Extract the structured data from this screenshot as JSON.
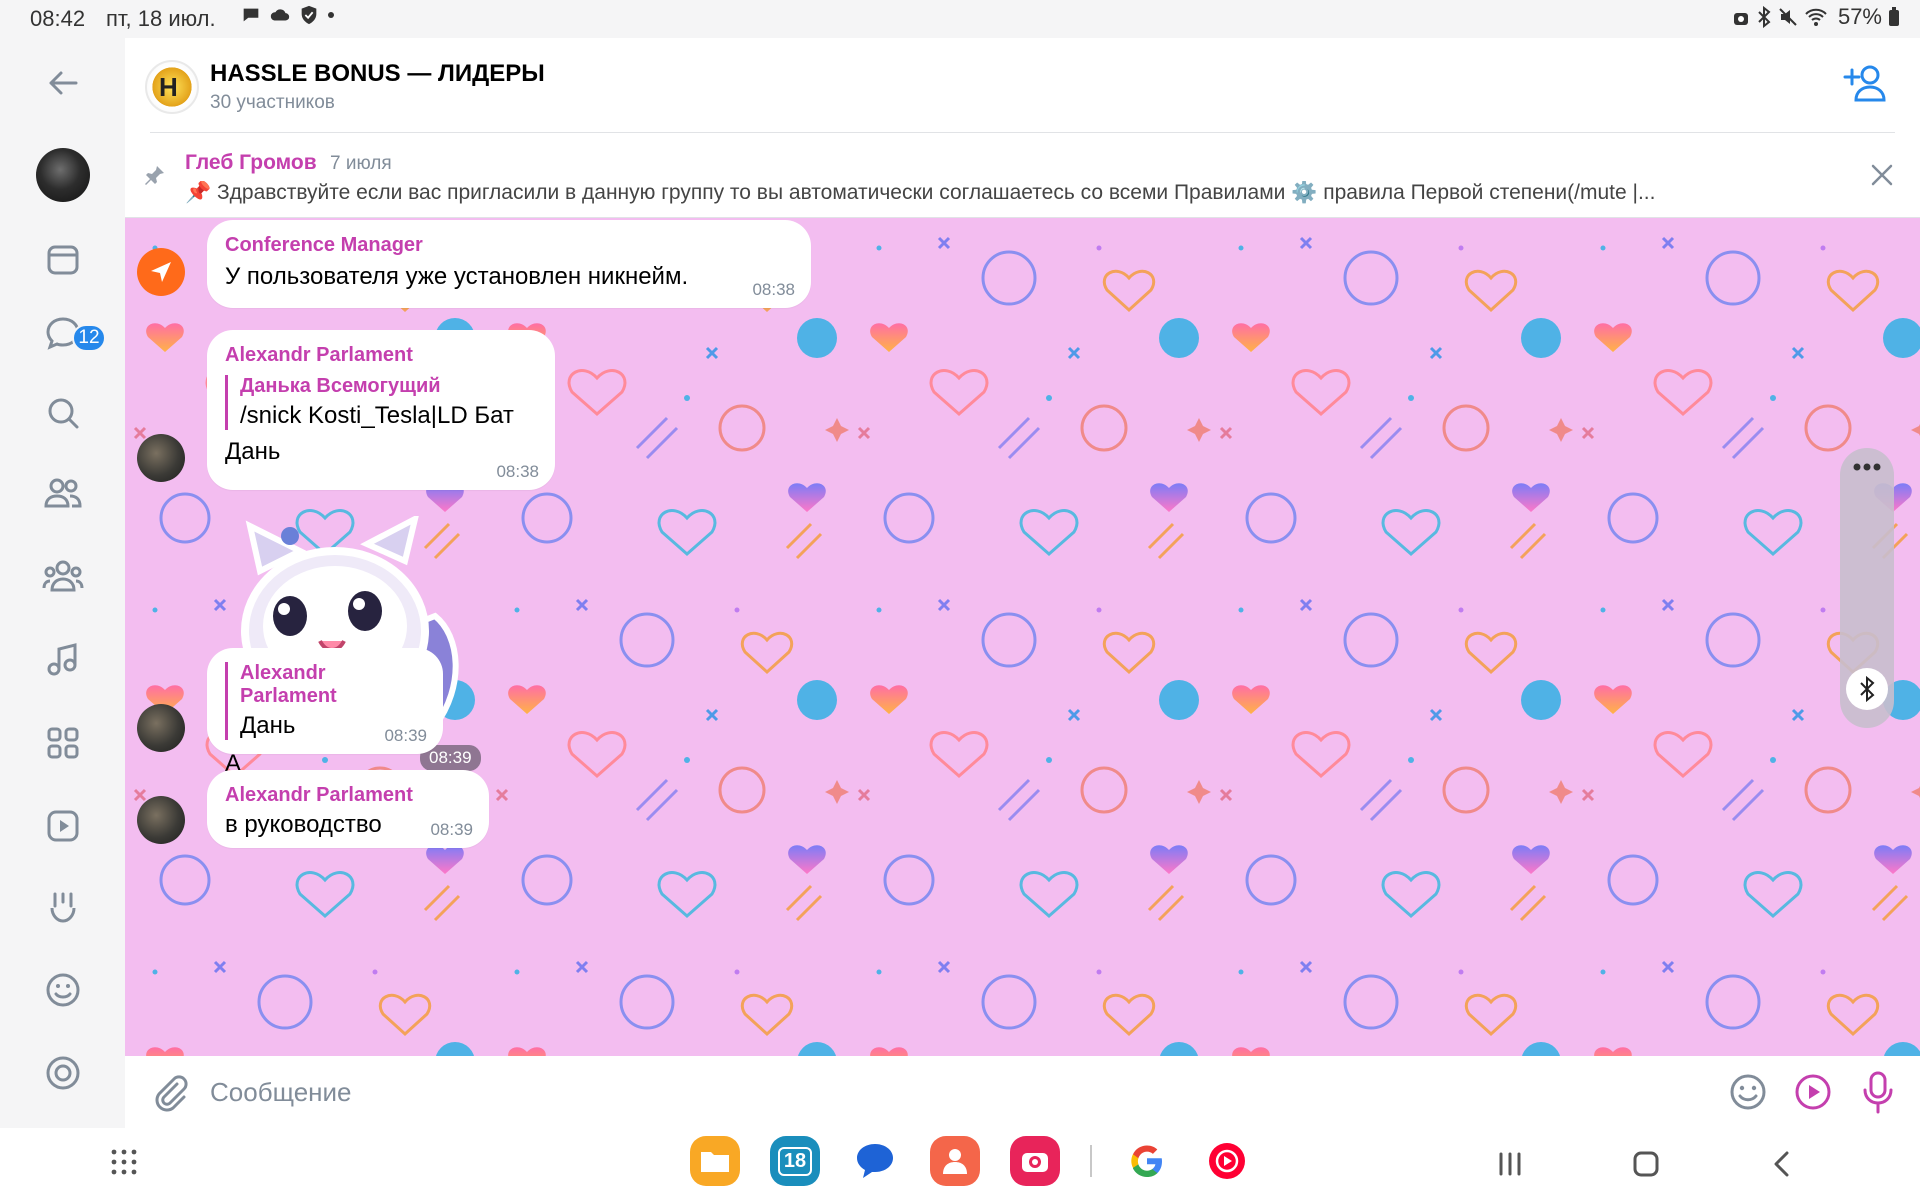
{
  "status_bar": {
    "time": "08:42",
    "date": "пт, 18 июл.",
    "battery": "57%"
  },
  "sidebar": {
    "unread_badge": "12"
  },
  "header": {
    "title": "HASSLE BONUS — ЛИДЕРЫ",
    "subtitle": "30 участников"
  },
  "pinned": {
    "author": "Глеб Громов",
    "date": "7 июля",
    "text": "📌 Здравствуйте если вас пригласили в данную группу то вы автоматически соглашаетесь со всеми Правилами ⚙️ правила Первой степени(/mute |..."
  },
  "messages": [
    {
      "sender": "Conference Manager",
      "text": "У пользователя уже установлен никнейм.",
      "time": "08:38"
    },
    {
      "sender": "Alexandr Parlament",
      "reply_name": "Данька Всемогущий",
      "reply_text": "/snick Kosti_Tesla|LD Бат",
      "text": "Дань",
      "time": "08:38"
    },
    {
      "sticker_time": "08:39"
    },
    {
      "sender": "Alexandr Parlament",
      "reply_text": "Дань",
      "text": "А",
      "time": "08:39"
    },
    {
      "sender": "Alexandr Parlament",
      "text": "в руководство",
      "time": "08:39"
    }
  ],
  "composer": {
    "placeholder": "Сообщение"
  },
  "dock": {
    "calendar_day": "18"
  },
  "colors": {
    "accent": "#2688eb",
    "sender": "#c43fae",
    "chat_bg": "#f3bdf0"
  }
}
